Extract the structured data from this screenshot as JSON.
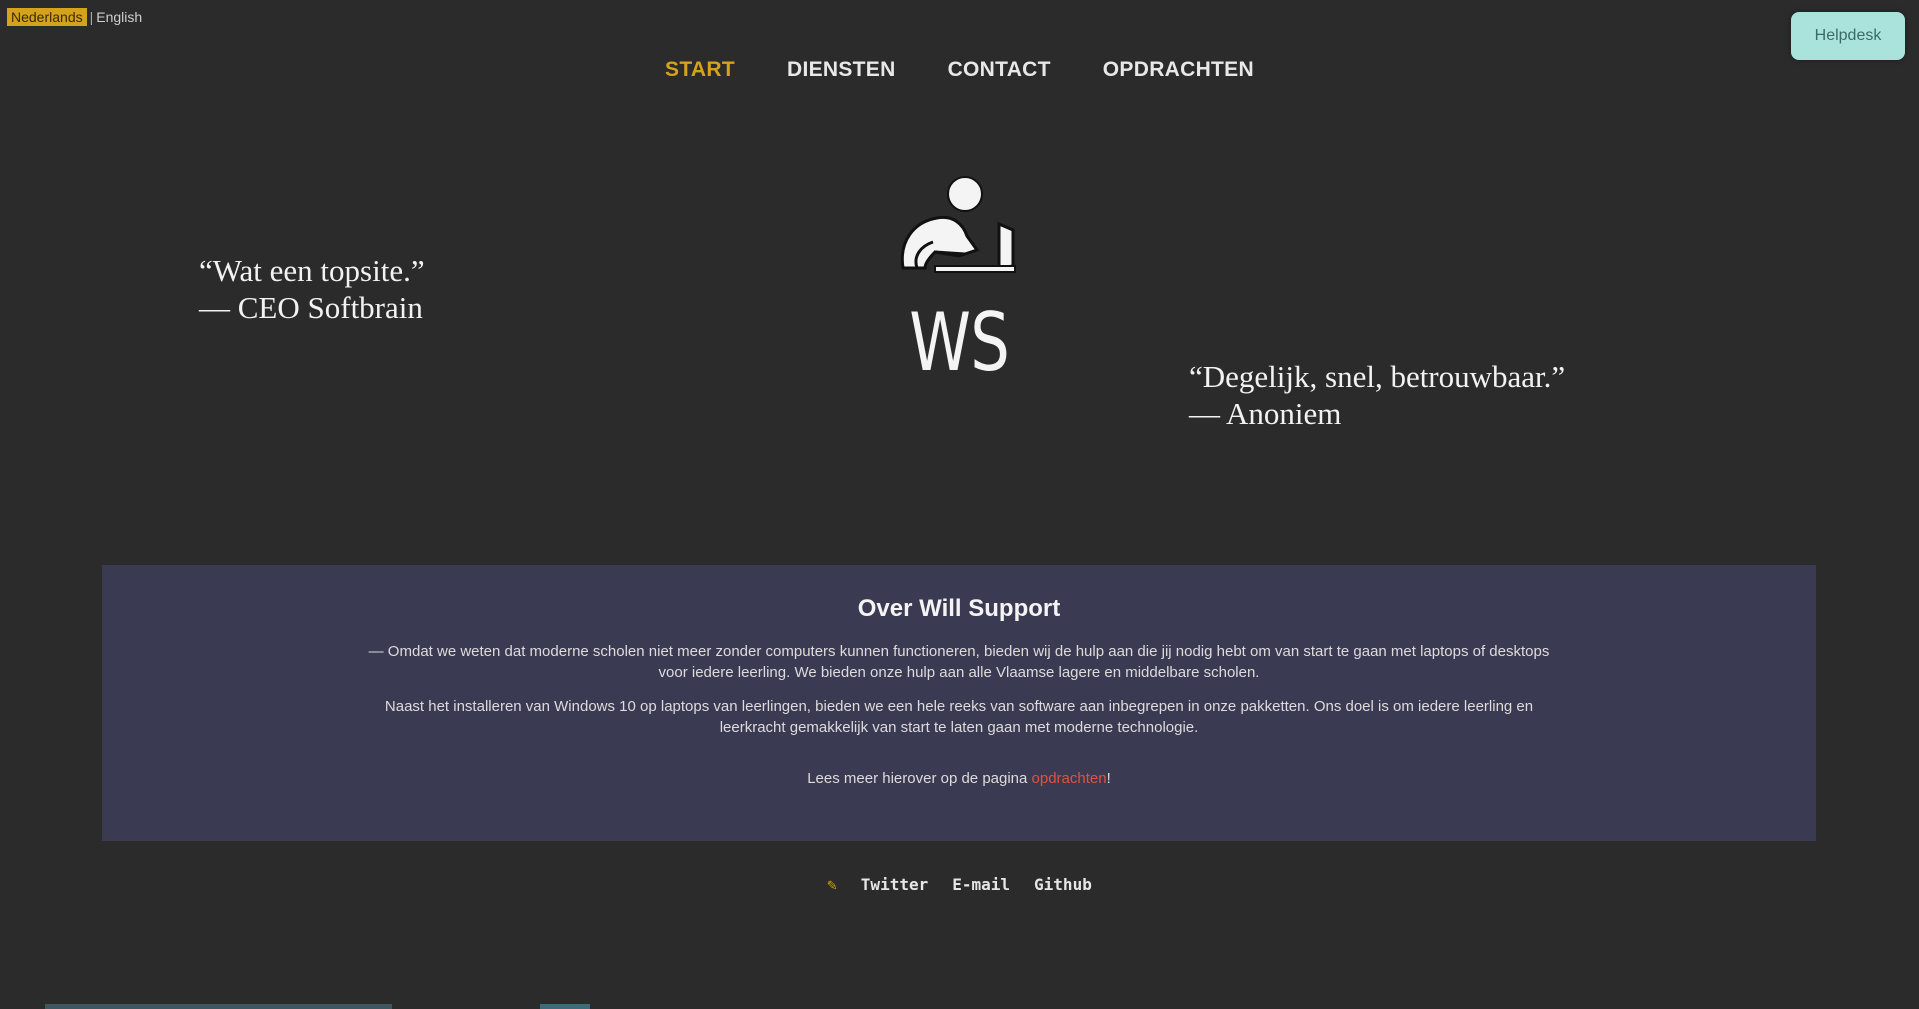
{
  "language": {
    "active": "Nederlands",
    "separator": "|",
    "other": "English"
  },
  "helpdesk": {
    "label": "Helpdesk"
  },
  "nav": {
    "items": [
      {
        "label": "START",
        "active": true
      },
      {
        "label": "DIENSTEN",
        "active": false
      },
      {
        "label": "CONTACT",
        "active": false
      },
      {
        "label": "OPDRACHTEN",
        "active": false
      }
    ]
  },
  "hero": {
    "logo_icon": "person-at-laptop-icon",
    "brand": "WS",
    "quote1": {
      "text": "“Wat een topsite.”",
      "author": "— CEO Softbrain"
    },
    "quote2": {
      "text": "“Degelijk, snel, betrouwbaar.”",
      "author": "— Anoniem"
    }
  },
  "about": {
    "title": "Over Will Support",
    "paragraph1": "— Omdat we weten dat moderne scholen niet meer zonder computers kunnen functioneren, bieden wij de hulp aan die jij nodig hebt om van start te gaan met laptops of desktops voor iedere leerling. We bieden onze hulp aan alle Vlaamse lagere en middelbare scholen.",
    "paragraph2": "Naast het installeren van Windows 10 op laptops van leerlingen, bieden we een hele reeks van software aan inbegrepen in onze pakketten. Ons doel is om iedere leerling en leerkracht gemakkelijk van start te laten gaan met moderne technologie.",
    "readmore_prefix": "Lees meer hierover op de pagina ",
    "readmore_link": "opdrachten",
    "readmore_suffix": "!"
  },
  "footer": {
    "spark": "✎",
    "links": [
      "Twitter",
      "E-mail",
      "Github"
    ]
  },
  "colors": {
    "background": "#2b2b2b",
    "accent": "#d4a21b",
    "panel": "#3a3a52",
    "helpdesk": "#a9e3dc",
    "link": "#e0523c"
  }
}
